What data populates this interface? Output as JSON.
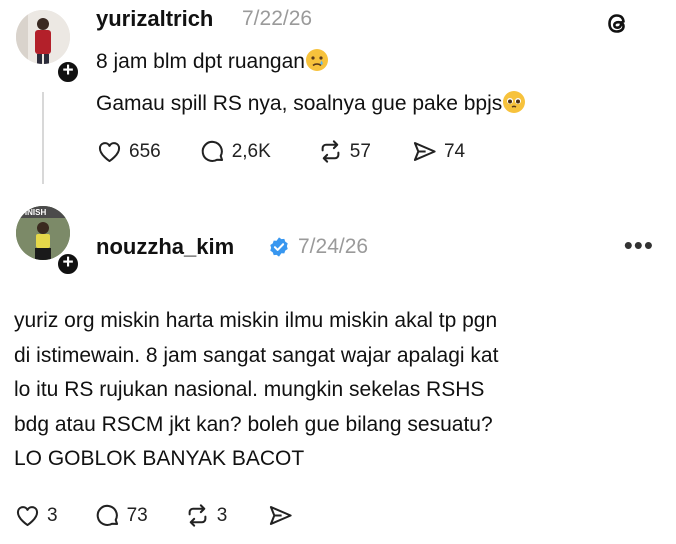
{
  "posts": [
    {
      "username": "yurizaltrich",
      "date": "7/22/26",
      "lines": [
        "8 jam blm dpt ruangan",
        "Gamau spill RS nya, soalnya gue pake bpjs"
      ],
      "line_emojis": [
        "crying-face",
        "pleading-face"
      ],
      "stats": {
        "likes": "656",
        "replies": "2,6K",
        "reposts": "57",
        "shares": "74"
      }
    },
    {
      "username": "nouzzha_kim",
      "verified": true,
      "date": "7/24/26",
      "lines": [
        "yuriz org miskin harta miskin ilmu miskin akal tp pgn",
        "di istimewain. 8 jam sangat sangat wajar apalagi kat",
        "lo itu RS rujukan nasional. mungkin sekelas RSHS",
        "bdg atau RSCM jkt kan? boleh gue bilang sesuatu?",
        "LO GOBLOK BANYAK BACOT"
      ],
      "stats": {
        "likes": "3",
        "replies": "73",
        "reposts": "3",
        "shares": ""
      }
    }
  ],
  "avatar_badge": "+",
  "more_label": "•••",
  "icons": [
    "threads-logo-icon",
    "heart-icon",
    "comment-icon",
    "repost-icon",
    "share-icon",
    "verified-badge-icon",
    "more-icon"
  ],
  "colors": {
    "text": "#111111",
    "muted": "#9a9a9a",
    "verified": "#3897f0",
    "thread_line": "#d8d8d8"
  }
}
